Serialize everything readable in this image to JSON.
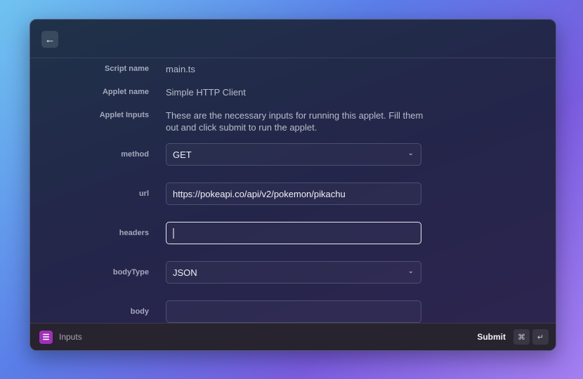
{
  "header": {
    "back_icon": "arrow-left-icon"
  },
  "meta": [
    {
      "label": "Script name",
      "value": "main.ts"
    },
    {
      "label": "Applet name",
      "value": "Simple HTTP Client"
    },
    {
      "label": "Applet Inputs",
      "value": "These are the necessary inputs for running this applet. Fill them out and click submit to run the applet."
    }
  ],
  "fields": {
    "method": {
      "label": "method",
      "value": "GET"
    },
    "url": {
      "label": "url",
      "value": "https://pokeapi.co/api/v2/pokemon/pikachu"
    },
    "headers": {
      "label": "headers",
      "value": ""
    },
    "bodyType": {
      "label": "bodyType",
      "value": "JSON"
    },
    "body": {
      "label": "body",
      "value": ""
    }
  },
  "footer": {
    "title": "Inputs",
    "submit": "Submit",
    "key1": "⌘",
    "key2": "↵"
  }
}
